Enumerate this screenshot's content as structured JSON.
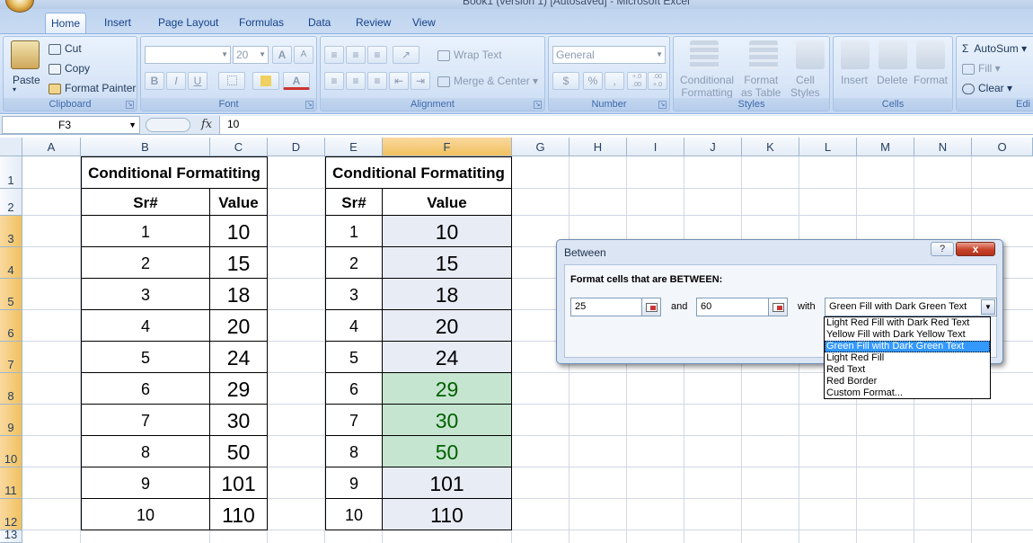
{
  "window": {
    "title": "Book1 (version 1) [Autosaved] - Microsoft Excel"
  },
  "tabs": [
    "Home",
    "Insert",
    "Page Layout",
    "Formulas",
    "Data",
    "Review",
    "View"
  ],
  "ribbon": {
    "clipboard": {
      "label": "Clipboard",
      "paste": "Paste",
      "cut": "Cut",
      "copy": "Copy",
      "format_painter": "Format Painter"
    },
    "font": {
      "label": "Font",
      "font_name": "",
      "font_size": "20",
      "bold": "B",
      "italic": "I",
      "underline": "U",
      "grow": "A",
      "shrink": "A",
      "color": "A"
    },
    "alignment": {
      "label": "Alignment",
      "wrap_text": "Wrap Text",
      "merge_center": "Merge & Center"
    },
    "number": {
      "label": "Number",
      "format": "General",
      "currency": "$",
      "percent": "%",
      "comma": ",",
      "inc": "+.0 .00",
      "dec": ".00 +.0"
    },
    "styles": {
      "label": "Styles",
      "conditional": [
        "Conditional",
        "Formatting"
      ],
      "format_table": [
        "Format",
        "as Table"
      ],
      "cell_styles": [
        "Cell",
        "Styles"
      ]
    },
    "cells": {
      "label": "Cells",
      "insert": "Insert",
      "delete": "Delete",
      "format": "Format"
    },
    "editing": {
      "label": "Edi",
      "autosum": "AutoSum",
      "fill": "Fill",
      "clear": "Clear"
    }
  },
  "formula_bar": {
    "name_box": "F3",
    "fx": "fx",
    "value": "10"
  },
  "columns": [
    "A",
    "B",
    "C",
    "D",
    "E",
    "F",
    "G",
    "H",
    "I",
    "J",
    "K",
    "L",
    "M",
    "N",
    "O"
  ],
  "selected_column": "F",
  "rows": [
    "1",
    "2",
    "3",
    "4",
    "5",
    "6",
    "7",
    "8",
    "9",
    "10",
    "11",
    "12",
    "13"
  ],
  "table_left": {
    "title": "Conditional Formatiting",
    "headers": [
      "Sr#",
      "Value"
    ],
    "sr": [
      "1",
      "2",
      "3",
      "4",
      "5",
      "6",
      "7",
      "8",
      "9",
      "10"
    ],
    "values": [
      "10",
      "15",
      "18",
      "20",
      "24",
      "29",
      "30",
      "50",
      "101",
      "110"
    ]
  },
  "table_right": {
    "title": "Conditional Formatiting",
    "headers": [
      "Sr#",
      "Value"
    ],
    "sr": [
      "1",
      "2",
      "3",
      "4",
      "5",
      "6",
      "7",
      "8",
      "9",
      "10"
    ],
    "values": [
      "10",
      "15",
      "18",
      "20",
      "24",
      "29",
      "30",
      "50",
      "101",
      "110"
    ]
  },
  "colors": {
    "highlight_fill": "#c6e5d0",
    "highlight_text": "#006100",
    "selection_fill": "#e8ecf5"
  },
  "dialog": {
    "title": "Between",
    "help": "?",
    "close": "x",
    "heading": "Format cells that are BETWEEN:",
    "value1": "25",
    "and_label": "and",
    "value2": "60",
    "with_label": "with",
    "selected_format": "Green Fill with Dark Green Text",
    "options": [
      "Light Red Fill with Dark Red Text",
      "Yellow Fill with Dark Yellow Text",
      "Green Fill with Dark Green Text",
      "Light Red Fill",
      "Red Text",
      "Red Border",
      "Custom Format..."
    ]
  }
}
